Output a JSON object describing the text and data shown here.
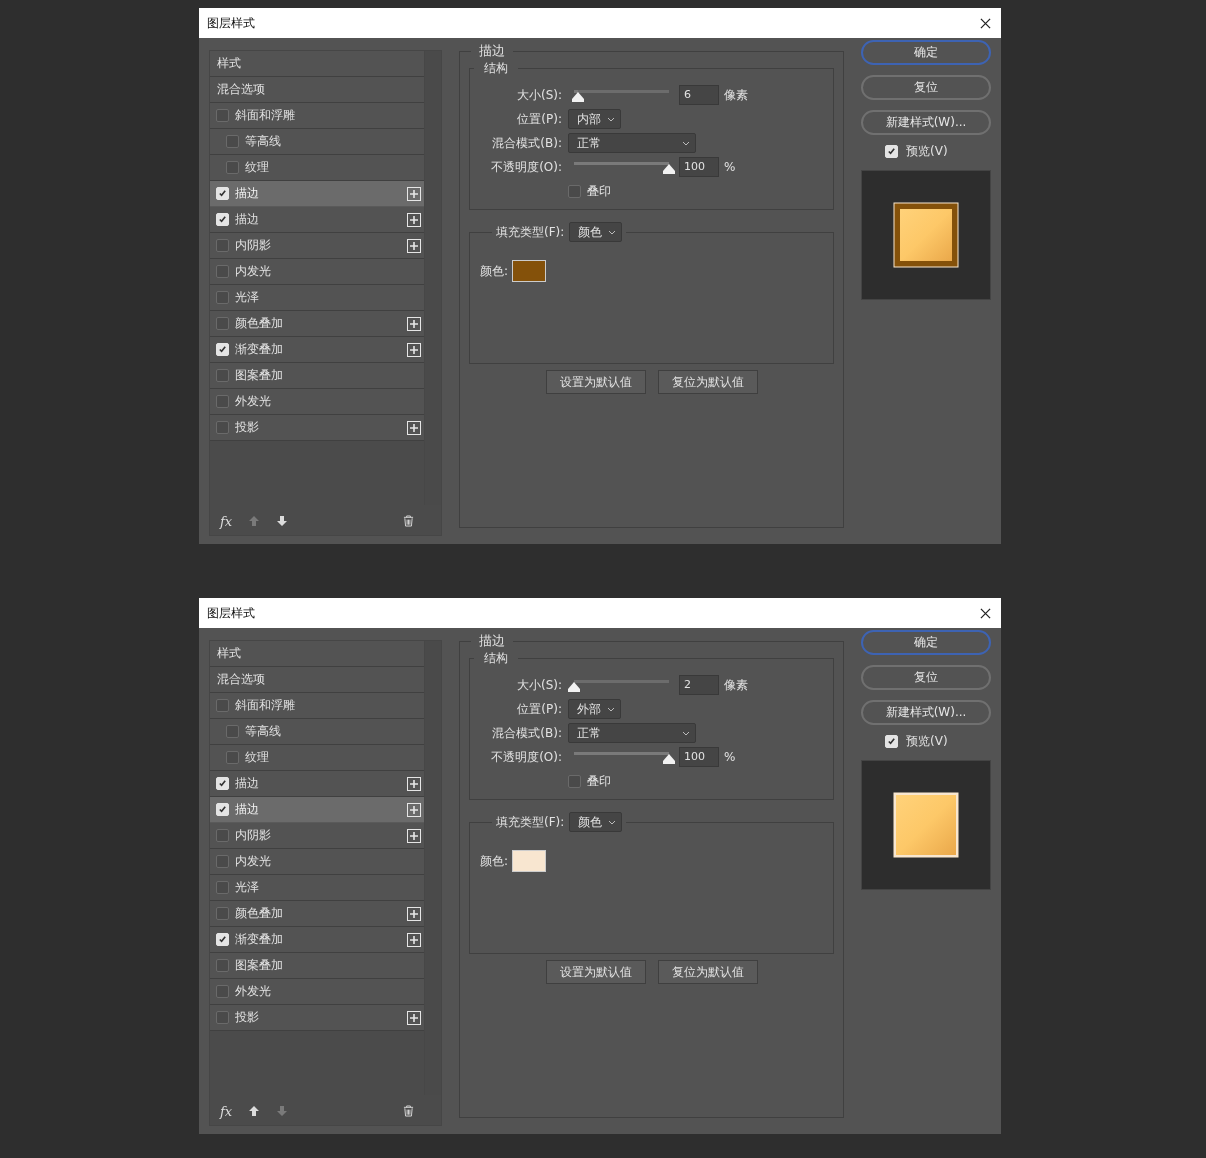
{
  "dialogs": [
    {
      "title": "图层样式",
      "effects": [
        {
          "label": "样式",
          "kind": "header",
          "selected": false
        },
        {
          "label": "混合选项",
          "kind": "header",
          "selected": false
        },
        {
          "label": "斜面和浮雕",
          "kind": "checkbox",
          "checked": false,
          "selected": false,
          "addable": false,
          "children": [
            {
              "label": "等高线",
              "kind": "checkbox",
              "checked": false,
              "selected": false,
              "addable": false
            },
            {
              "label": "纹理",
              "kind": "checkbox",
              "checked": false,
              "selected": false,
              "addable": false
            }
          ]
        },
        {
          "label": "描边",
          "kind": "checkbox",
          "checked": true,
          "selected": true,
          "addable": true
        },
        {
          "label": "描边",
          "kind": "checkbox",
          "checked": true,
          "selected": false,
          "addable": true
        },
        {
          "label": "内阴影",
          "kind": "checkbox",
          "checked": false,
          "selected": false,
          "addable": true
        },
        {
          "label": "内发光",
          "kind": "checkbox",
          "checked": false,
          "selected": false,
          "addable": false
        },
        {
          "label": "光泽",
          "kind": "checkbox",
          "checked": false,
          "selected": false,
          "addable": false
        },
        {
          "label": "颜色叠加",
          "kind": "checkbox",
          "checked": false,
          "selected": false,
          "addable": true
        },
        {
          "label": "渐变叠加",
          "kind": "checkbox",
          "checked": true,
          "selected": false,
          "addable": true
        },
        {
          "label": "图案叠加",
          "kind": "checkbox",
          "checked": false,
          "selected": false,
          "addable": false
        },
        {
          "label": "外发光",
          "kind": "checkbox",
          "checked": false,
          "selected": false,
          "addable": false
        },
        {
          "label": "投影",
          "kind": "checkbox",
          "checked": false,
          "selected": false,
          "addable": true
        }
      ],
      "footer": {
        "fx": "fx",
        "move_up_disabled": true,
        "move_down_disabled": false
      },
      "panel": {
        "title": "描边",
        "structure_title": "结构",
        "size": {
          "label": "大小(S):",
          "value": "6",
          "unit": "像素",
          "level": 0.04
        },
        "position": {
          "label": "位置(P):",
          "value": "内部"
        },
        "blend_mode": {
          "label": "混合模式(B):",
          "value": "正常"
        },
        "opacity": {
          "label": "不透明度(O):",
          "value": "100",
          "unit": "%",
          "level": 1
        },
        "overprint": {
          "label": "叠印",
          "checked": false
        },
        "fill_type": {
          "label": "填充类型(F):",
          "value": "颜色"
        },
        "color": {
          "label": "颜色:",
          "color": "#84510a"
        },
        "buttons": [
          "设置为默认值",
          "复位为默认值"
        ]
      },
      "side_buttons": [
        {
          "label": "确定",
          "default": true
        },
        {
          "label": "复位",
          "default": false
        },
        {
          "label": "新建样式(W)...",
          "default": false
        }
      ],
      "preview": {
        "label": "预览(V)",
        "checked": true
      }
    },
    {
      "title": "图层样式",
      "effects": [
        {
          "label": "样式",
          "kind": "header",
          "selected": false
        },
        {
          "label": "混合选项",
          "kind": "header",
          "selected": false
        },
        {
          "label": "斜面和浮雕",
          "kind": "checkbox",
          "checked": false,
          "selected": false,
          "addable": false,
          "children": [
            {
              "label": "等高线",
              "kind": "checkbox",
              "checked": false,
              "selected": false,
              "addable": false
            },
            {
              "label": "纹理",
              "kind": "checkbox",
              "checked": false,
              "selected": false,
              "addable": false
            }
          ]
        },
        {
          "label": "描边",
          "kind": "checkbox",
          "checked": true,
          "selected": false,
          "addable": true
        },
        {
          "label": "描边",
          "kind": "checkbox",
          "checked": true,
          "selected": true,
          "addable": true
        },
        {
          "label": "内阴影",
          "kind": "checkbox",
          "checked": false,
          "selected": false,
          "addable": true
        },
        {
          "label": "内发光",
          "kind": "checkbox",
          "checked": false,
          "selected": false,
          "addable": false
        },
        {
          "label": "光泽",
          "kind": "checkbox",
          "checked": false,
          "selected": false,
          "addable": false
        },
        {
          "label": "颜色叠加",
          "kind": "checkbox",
          "checked": false,
          "selected": false,
          "addable": true
        },
        {
          "label": "渐变叠加",
          "kind": "checkbox",
          "checked": true,
          "selected": false,
          "addable": true
        },
        {
          "label": "图案叠加",
          "kind": "checkbox",
          "checked": false,
          "selected": false,
          "addable": false
        },
        {
          "label": "外发光",
          "kind": "checkbox",
          "checked": false,
          "selected": false,
          "addable": false
        },
        {
          "label": "投影",
          "kind": "checkbox",
          "checked": false,
          "selected": false,
          "addable": true
        }
      ],
      "footer": {
        "fx": "fx",
        "move_up_disabled": false,
        "move_down_disabled": true
      },
      "panel": {
        "title": "描边",
        "structure_title": "结构",
        "size": {
          "label": "大小(S):",
          "value": "2",
          "unit": "像素",
          "level": 0
        },
        "position": {
          "label": "位置(P):",
          "value": "外部"
        },
        "blend_mode": {
          "label": "混合模式(B):",
          "value": "正常"
        },
        "opacity": {
          "label": "不透明度(O):",
          "value": "100",
          "unit": "%",
          "level": 1
        },
        "overprint": {
          "label": "叠印",
          "checked": false
        },
        "fill_type": {
          "label": "填充类型(F):",
          "value": "颜色"
        },
        "color": {
          "label": "颜色:",
          "color": "#f8e6d0"
        },
        "buttons": [
          "设置为默认值",
          "复位为默认值"
        ]
      },
      "side_buttons": [
        {
          "label": "确定",
          "default": true
        },
        {
          "label": "复位",
          "default": false
        },
        {
          "label": "新建样式(W)...",
          "default": false
        }
      ],
      "preview": {
        "label": "预览(V)",
        "checked": true
      }
    }
  ]
}
